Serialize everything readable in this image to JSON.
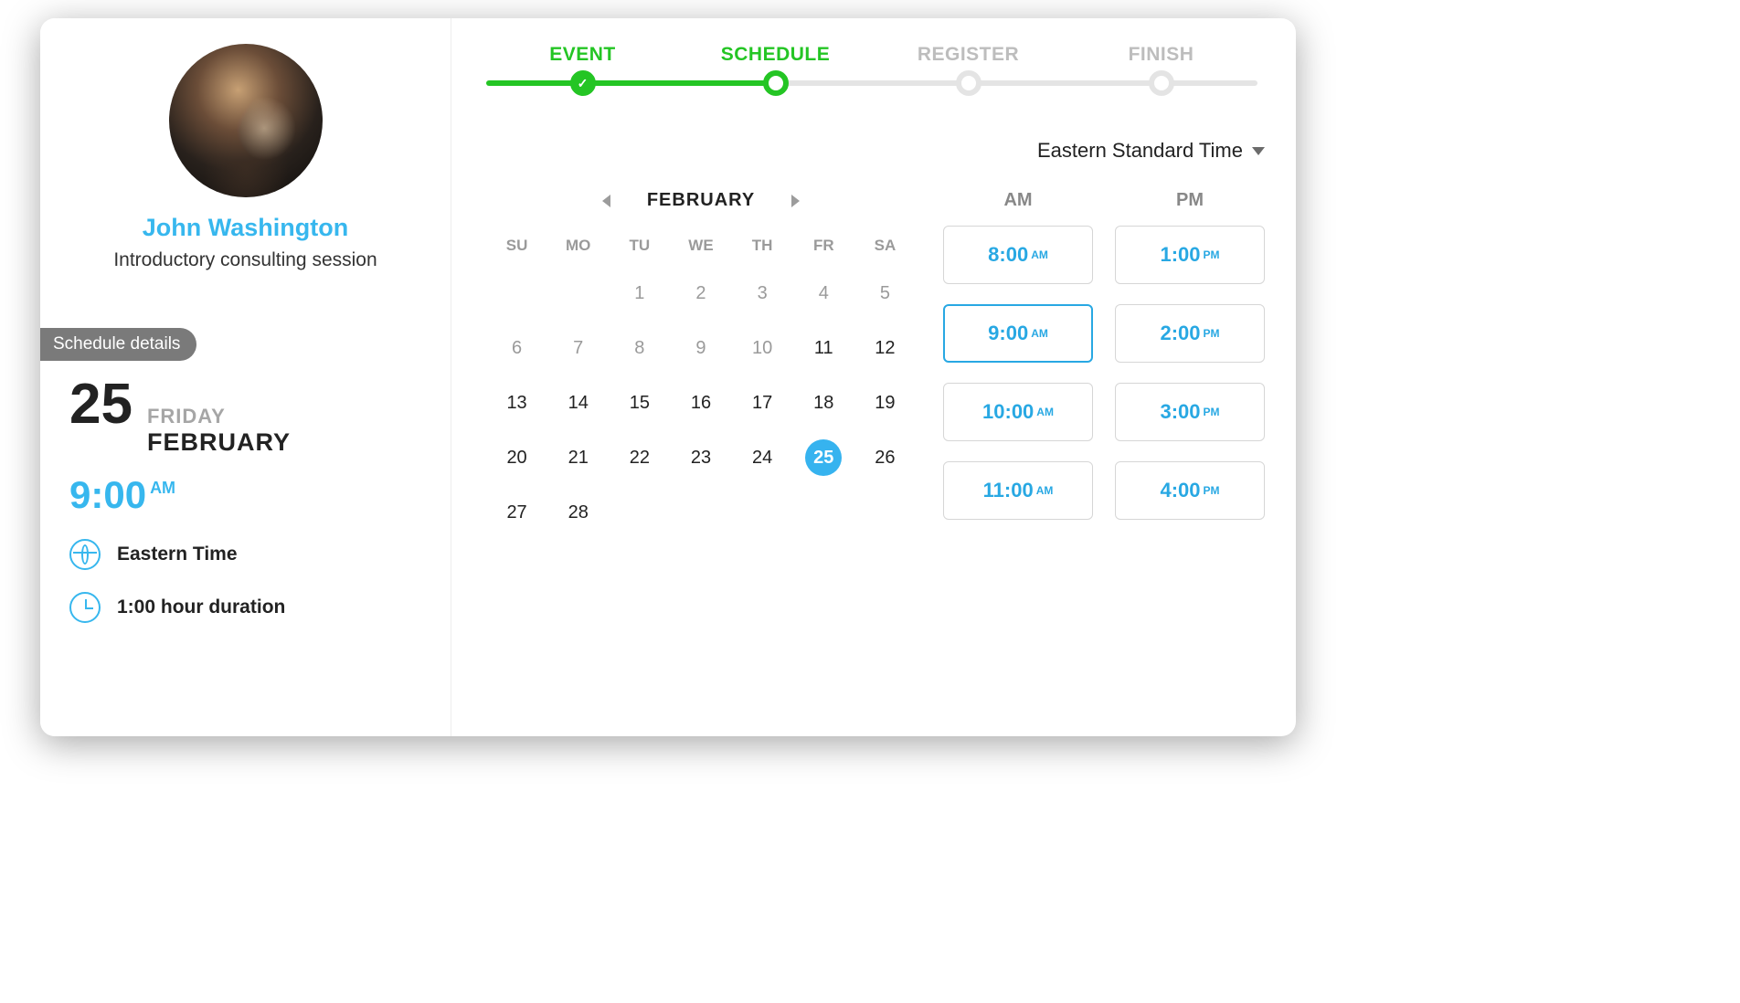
{
  "sidebar": {
    "person_name": "John Washington",
    "session_title": "Introductory consulting session",
    "details_label": "Schedule details",
    "selected_date": {
      "day_number": "25",
      "weekday": "FRIDAY",
      "month": "FEBRUARY"
    },
    "selected_time": {
      "value": "9:00",
      "meridiem": "AM"
    },
    "timezone": "Eastern Time",
    "duration": "1:00 hour duration"
  },
  "stepper": {
    "steps": [
      {
        "label": "EVENT",
        "state": "done"
      },
      {
        "label": "SCHEDULE",
        "state": "active"
      },
      {
        "label": "REGISTER",
        "state": "pending"
      },
      {
        "label": "FINISH",
        "state": "pending"
      }
    ]
  },
  "timezone_picker": "Eastern Standard Time",
  "calendar": {
    "month_label": "FEBRUARY",
    "dow": [
      "SU",
      "MO",
      "TU",
      "WE",
      "TH",
      "FR",
      "SA"
    ],
    "weeks": [
      [
        null,
        null,
        "1",
        "2",
        "3",
        "4",
        "5"
      ],
      [
        "6",
        "7",
        "8",
        "9",
        "10",
        "11",
        "12"
      ],
      [
        "13",
        "14",
        "15",
        "16",
        "17",
        "18",
        "19"
      ],
      [
        "20",
        "21",
        "22",
        "23",
        "24",
        "25",
        "26"
      ],
      [
        "27",
        "28",
        null,
        null,
        null,
        null,
        null
      ]
    ],
    "disabled_cutoff": 10,
    "selected_day": "25"
  },
  "slots": {
    "heads": {
      "am": "AM",
      "pm": "PM"
    },
    "rows": [
      {
        "am": {
          "t": "8:00",
          "m": "AM"
        },
        "pm": {
          "t": "1:00",
          "m": "PM"
        }
      },
      {
        "am": {
          "t": "9:00",
          "m": "AM",
          "selected": true
        },
        "pm": {
          "t": "2:00",
          "m": "PM"
        }
      },
      {
        "am": {
          "t": "10:00",
          "m": "AM"
        },
        "pm": {
          "t": "3:00",
          "m": "PM"
        }
      },
      {
        "am": {
          "t": "11:00",
          "m": "AM"
        },
        "pm": {
          "t": "4:00",
          "m": "PM"
        }
      }
    ]
  }
}
